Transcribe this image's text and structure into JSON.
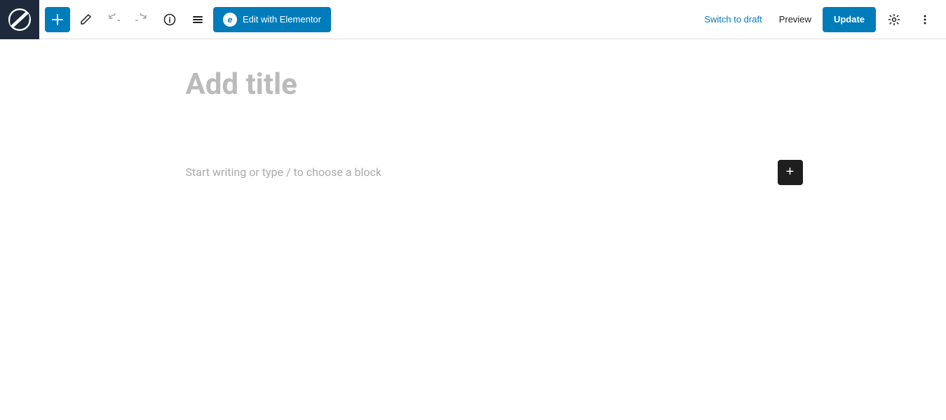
{
  "toolbar": {
    "wp_logo_label": "WordPress",
    "add_button_label": "+",
    "edit_tool_label": "Edit",
    "undo_label": "Undo",
    "redo_label": "Redo",
    "info_label": "Info",
    "list_view_label": "List View",
    "edit_with_elementor_label": "Edit with Elementor",
    "elementor_icon": "e",
    "switch_to_draft_label": "Switch to draft",
    "preview_label": "Preview",
    "update_label": "Update",
    "settings_label": "Settings",
    "more_options_label": "More options"
  },
  "editor": {
    "title_placeholder": "Add title",
    "block_placeholder": "Start writing or type / to choose a block",
    "add_block_label": "+"
  }
}
